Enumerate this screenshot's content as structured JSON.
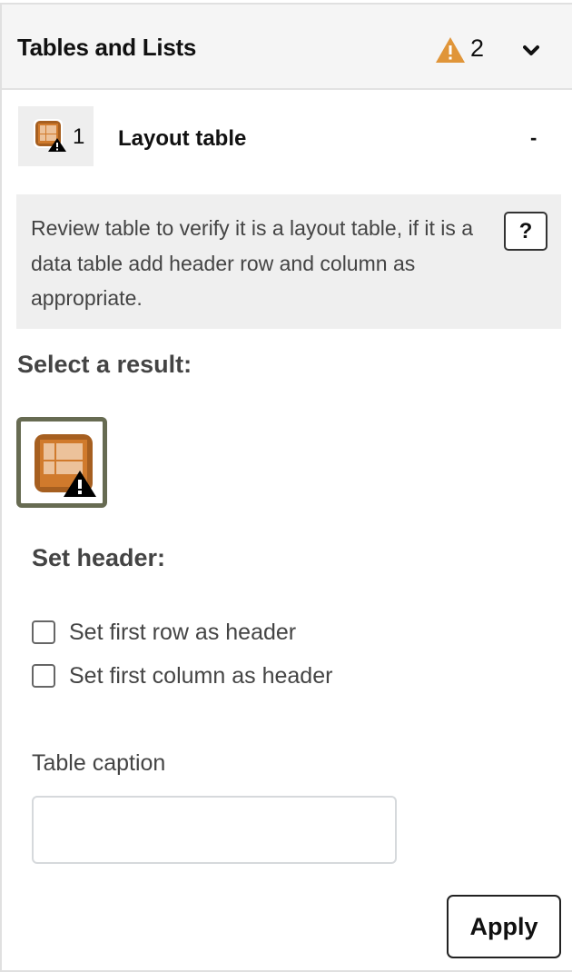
{
  "section": {
    "title": "Tables and Lists",
    "warning_icon": "warning-triangle-icon",
    "warning_count": "2",
    "toggle_icon": "chevron-down-icon",
    "warning_color": "#e09539"
  },
  "issue": {
    "icon": "layout-table-warning-icon",
    "count": "1",
    "title": "Layout table",
    "status": "-"
  },
  "help": {
    "text": "Review table to verify it is a layout table, if it is a data table add header row and column as appropriate.",
    "button_label": "?"
  },
  "select_result": {
    "label": "Select a result:",
    "options": [
      {
        "name": "layout-table",
        "icon": "layout-table-warning-icon",
        "selected": true
      }
    ],
    "selected_border_color": "#676b52"
  },
  "set_header": {
    "label": "Set header:",
    "options": [
      {
        "label": "Set first row as header",
        "checked": false
      },
      {
        "label": "Set first column as header",
        "checked": false
      }
    ]
  },
  "caption": {
    "label": "Table caption",
    "value": "",
    "placeholder": ""
  },
  "actions": {
    "apply_label": "Apply"
  }
}
